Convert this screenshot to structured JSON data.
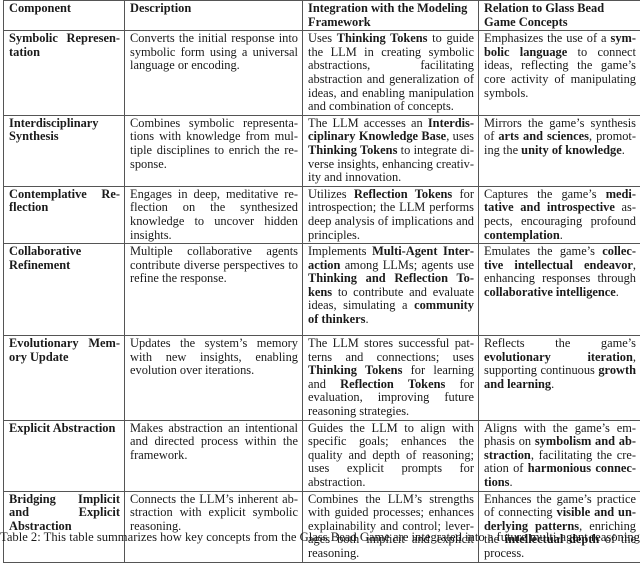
{
  "table": {
    "headers": [
      "Component",
      "Description",
      "Integration with the Modeling Framework",
      "Relation to Glass Bead Game Concepts"
    ],
    "rows": [
      {
        "component": "Symbolic Represen-tation",
        "description": "Converts the initial response into symbolic form using a universal language or encoding.",
        "integration": [
          [
            "",
            "Uses "
          ],
          [
            "b",
            "Thinking Tokens"
          ],
          [
            "",
            " to guide the LLM in creating symbolic ab­stractions, facilitating abstraction and generalization of ideas, and enabling manipulation and combi­nation of concepts."
          ]
        ],
        "relation": [
          [
            "",
            "Emphasizes the use of a "
          ],
          [
            "b",
            "sym­bolic language"
          ],
          [
            "",
            " to connect ideas, reflecting the game’s core activity of manipulating symbols."
          ]
        ]
      },
      {
        "component": "Interdisciplinary Synthesis",
        "description": "Combines symbolic representa­tions with knowledge from mul­tiple disciplines to enrich the re­sponse.",
        "integration": [
          [
            "",
            "The LLM accesses an "
          ],
          [
            "b",
            "Interdis­ciplinary Knowledge Base"
          ],
          [
            "",
            ", uses "
          ],
          [
            "b",
            "Thinking Tokens"
          ],
          [
            "",
            " to integrate di­verse insights, enhancing creativ­ity and innovation."
          ]
        ],
        "relation": [
          [
            "",
            "Mirrors the game’s synthesis of "
          ],
          [
            "b",
            "arts and sciences"
          ],
          [
            "",
            ", promot­ing the "
          ],
          [
            "b",
            "unity of knowledge"
          ],
          [
            "",
            "."
          ]
        ]
      },
      {
        "component": "Contemplative Re­flection",
        "description": "Engages in deep, meditative re­flection on the synthesized knowl­edge to uncover hidden insights.",
        "integration": [
          [
            "",
            "Utilizes "
          ],
          [
            "b",
            "Reflection Tokens"
          ],
          [
            "",
            " for in­trospection; the LLM performs deep analysis of implications and principles."
          ]
        ],
        "relation": [
          [
            "",
            "Captures the game’s "
          ],
          [
            "b",
            "medi­tative and introspective"
          ],
          [
            "",
            " as­pects, encouraging profound "
          ],
          [
            "b",
            "contemplation"
          ],
          [
            "",
            "."
          ]
        ]
      },
      {
        "component": "Collaborative Refine­ment",
        "description": "Multiple collaborative agents con­tribute diverse perspectives to re­fine the response.",
        "integration": [
          [
            "",
            "Implements "
          ],
          [
            "b",
            "Multi-Agent Inter­action"
          ],
          [
            "",
            " among LLMs; agents use "
          ],
          [
            "b",
            "Thinking and Reflection To­kens"
          ],
          [
            "",
            " to contribute and evaluate ideas, simulating a "
          ],
          [
            "b",
            "community of thinkers"
          ],
          [
            "",
            "."
          ]
        ],
        "relation": [
          [
            "",
            "Emulates the game’s "
          ],
          [
            "b",
            "collec­tive intellectual endeavor"
          ],
          [
            "",
            ", en­hancing responses through "
          ],
          [
            "b",
            "col­laborative intelligence"
          ],
          [
            "",
            "."
          ]
        ]
      },
      {
        "component": "Evolutionary Mem­ory Update",
        "description": "Updates the system’s memory with new insights, enabling evolu­tion over iterations.",
        "integration": [
          [
            "",
            "The LLM stores successful pat­terns and connections; uses "
          ],
          [
            "b",
            "Thinking Tokens"
          ],
          [
            "",
            " for learning and "
          ],
          [
            "b",
            "Reflection Tokens"
          ],
          [
            "",
            " for evalu­ation, improving future reasoning strategies."
          ]
        ],
        "relation": [
          [
            "",
            "Reflects the game’s "
          ],
          [
            "b",
            "evolution­ary iteration"
          ],
          [
            "",
            ", supporting con­tinuous "
          ],
          [
            "b",
            "growth and learning"
          ],
          [
            "",
            "."
          ]
        ]
      },
      {
        "component": "Explicit Abstraction",
        "description": "Makes abstraction an intentional and directed process within the framework.",
        "integration": [
          [
            "",
            "Guides the LLM to align with spe­cific goals; enhances the quality and depth of reasoning; uses ex­plicit prompts for abstraction."
          ]
        ],
        "relation": [
          [
            "",
            "Aligns with the game’s em­phasis on "
          ],
          [
            "b",
            "symbolism and ab­straction"
          ],
          [
            "",
            ", facilitating the cre­ation of "
          ],
          [
            "b",
            "harmonious connec­tions"
          ],
          [
            "",
            "."
          ]
        ]
      },
      {
        "component": "Bridging Implicit and Explicit Abstrac­tion",
        "description": "Connects the LLM’s inherent ab­straction with explicit symbolic reasoning.",
        "integration": [
          [
            "",
            "Combines the LLM’s strengths with guided processes; enhances explainability and control; lever­ages both implicit and explicit rea­soning."
          ]
        ],
        "relation": [
          [
            "",
            "Enhances the game’s practice of connecting "
          ],
          [
            "b",
            "visible and un­derlying patterns"
          ],
          [
            "",
            ", enriching the "
          ],
          [
            "b",
            "intellectual depth"
          ],
          [
            "",
            " of the process."
          ]
        ]
      }
    ]
  },
  "caption": "Table 2: This table summarizes how key concepts from the Glass Bead Game are integrated into a future multi-agent reasoning"
}
